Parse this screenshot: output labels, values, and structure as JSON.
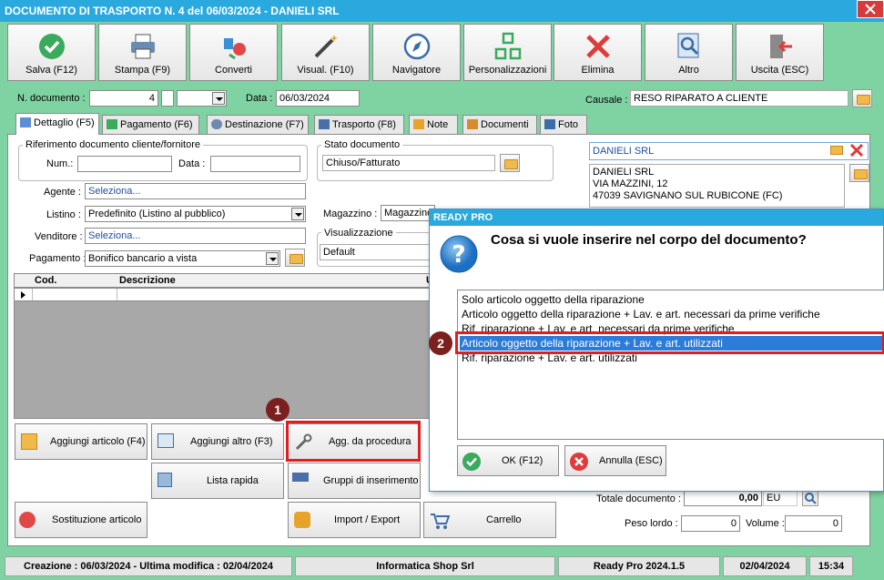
{
  "window": {
    "title": "DOCUMENTO DI TRASPORTO N. 4 del 06/03/2024 - DANIELI SRL"
  },
  "toolbar": [
    {
      "label": "Salva (F12)",
      "icon": "check-icon"
    },
    {
      "label": "Stampa (F9)",
      "icon": "printer-icon"
    },
    {
      "label": "Converti",
      "icon": "convert-icon"
    },
    {
      "label": "Visual. (F10)",
      "icon": "magic-wand-icon"
    },
    {
      "label": "Navigatore",
      "icon": "compass-icon"
    },
    {
      "label": "Personalizzazioni",
      "icon": "grid-icon"
    },
    {
      "label": "Elimina",
      "icon": "delete-x-icon"
    },
    {
      "label": "Altro",
      "icon": "magnifier-icon"
    },
    {
      "label": "Uscita (ESC)",
      "icon": "exit-door-icon"
    }
  ],
  "header": {
    "n_documento_label": "N. documento :",
    "n_documento_value": "4",
    "data_label": "Data :",
    "data_value": "06/03/2024",
    "causale_label": "Causale :",
    "causale_value": "RESO RIPARATO A CLIENTE"
  },
  "tabs": [
    {
      "label": "Dettaglio (F5)"
    },
    {
      "label": "Pagamento (F6)"
    },
    {
      "label": "Destinazione (F7)"
    },
    {
      "label": "Trasporto (F8)"
    },
    {
      "label": "Note"
    },
    {
      "label": "Documenti"
    },
    {
      "label": "Foto"
    }
  ],
  "riferimento": {
    "title": "Riferimento documento cliente/fornitore",
    "num_label": "Num.:",
    "num_value": "",
    "data_label": "Data :",
    "data_value": ""
  },
  "stato": {
    "title": "Stato documento",
    "value": "Chiuso/Fatturato"
  },
  "cliente": {
    "name": "DANIELI SRL",
    "address_line1": "DANIELI SRL",
    "address_line2": "VIA MAZZINI, 12",
    "address_line3": "47039 SAVIGNANO SUL RUBICONE (FC)"
  },
  "fields": {
    "agente_label": "Agente :",
    "agente_value": "Seleziona...",
    "listino_label": "Listino :",
    "listino_value": "Predefinito (Listino al pubblico)",
    "venditore_label": "Venditore :",
    "venditore_value": "Seleziona...",
    "pagamento_label": "Pagamento :",
    "pagamento_value": "Bonifico bancario a vista",
    "magazzino_label": "Magazzino :",
    "magazzino_value": "Magazzino",
    "visualizzazione_title": "Visualizzazione",
    "visualizzazione_value": "Default"
  },
  "grid": {
    "col_cod": "Cod.",
    "col_descrizione": "Descrizione",
    "col_u": "U"
  },
  "actions": {
    "aggiungi_articolo": "Aggiungi articolo (F4)",
    "aggiungi_altro": "Aggiungi altro (F3)",
    "agg_procedura": "Agg. da procedura",
    "lista_rapida": "Lista rapida",
    "gruppi_inserimento": "Gruppi di inserimento",
    "sostituzione_articolo": "Sostituzione articolo",
    "import_export": "Import / Export",
    "carrello": "Carrello"
  },
  "totals": {
    "totale_label": "Totale documento :",
    "totale_value": "0,00",
    "currency": "EU",
    "peso_label": "Peso lordo :",
    "peso_value": "0",
    "volume_label": "Volume :",
    "volume_value": "0"
  },
  "status": {
    "creazione": "Creazione : 06/03/2024 - Ultima modifica : 02/04/2024",
    "company": "Informatica Shop Srl",
    "version": "Ready Pro 2024.1.5",
    "date": "02/04/2024",
    "time": "15:34"
  },
  "dialog": {
    "title": "READY PRO",
    "question": "Cosa si vuole inserire nel corpo del documento?",
    "options": [
      "Solo articolo oggetto della riparazione",
      "Articolo oggetto della riparazione + Lav. e art. necessari da prime verifiche",
      "Rif. riparazione + Lav. e art. necessari da prime verifiche",
      "Articolo oggetto della riparazione + Lav. e art. utilizzati",
      "Rif. riparazione + Lav. e art. utilizzati"
    ],
    "selected_index": 3,
    "ok_label": "OK (F12)",
    "cancel_label": "Annulla (ESC)"
  },
  "callouts": {
    "one": "1",
    "two": "2"
  },
  "colors": {
    "accent": "#29a9de",
    "background": "#7fd3a3",
    "highlight": "#e11d1d",
    "selection": "#2c7bd8"
  }
}
